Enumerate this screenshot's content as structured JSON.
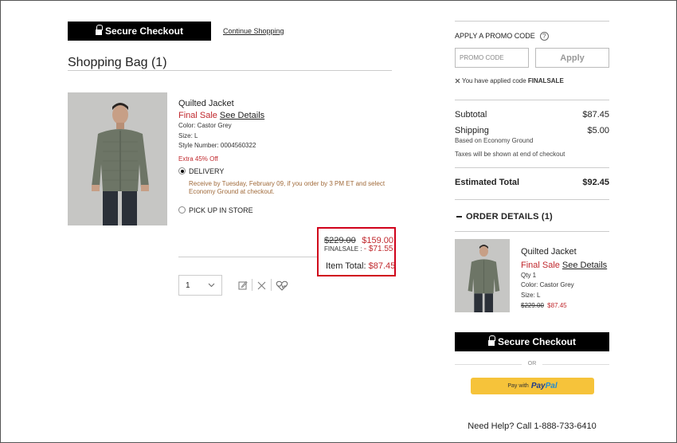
{
  "header": {
    "checkout_label": "Secure Checkout",
    "continue_label": "Continue Shopping",
    "bag_title": "Shopping Bag (1)"
  },
  "item": {
    "name": "Quilted Jacket",
    "final_sale": "Final Sale",
    "see_details": "See Details",
    "color": "Color: Castor Grey",
    "size_prefix": "Size: ",
    "size": "L",
    "style_prefix": "Style Number: ",
    "style_number": "0004560322",
    "discount_note": "Extra 45% Off",
    "delivery_label": "DELIVERY",
    "delivery_note_1": "Receive by Tuesday, February 09, if you order by 3 PM ET and select",
    "delivery_note_2": "Economy Ground at checkout.",
    "pickup_label": "PICK UP IN STORE",
    "quantity": "1"
  },
  "price_box": {
    "original": "$229.00",
    "sale": "$159.00",
    "promo_label": "FINALSALE : ",
    "promo_discount": "- $71.55",
    "total_label": "Item Total: ",
    "total_value": "$87.45"
  },
  "promo": {
    "title": "APPLY A PROMO CODE",
    "help": "?",
    "placeholder": "PROMO CODE",
    "apply_label": "Apply",
    "applied_text": "You have applied code ",
    "applied_code": "FINALSALE"
  },
  "summary": {
    "subtotal_label": "Subtotal",
    "subtotal_value": "$87.45",
    "shipping_label": "Shipping",
    "shipping_value": "$5.00",
    "shipping_method": "Based on Economy Ground",
    "tax_note": "Taxes will be shown at end of checkout",
    "estimated_label": "Estimated Total",
    "estimated_value": "$92.45"
  },
  "order_details": {
    "title": "ORDER DETAILS (1)",
    "name": "Quilted Jacket",
    "final_sale": "Final Sale",
    "see_details": "See Details",
    "qty": "Qty 1",
    "color": "Color: Castor Grey",
    "size": "Size: L",
    "original": "$229.00",
    "price": "$87.45"
  },
  "checkout": {
    "label": "Secure Checkout",
    "or": "OR",
    "paypal_prefix": "Pay with",
    "paypal_logo_a": "Pay",
    "paypal_logo_b": "Pal"
  },
  "help": {
    "text": "Need Help? Call 1-888-733-6410"
  },
  "colors": {
    "accent_red": "#c0282d",
    "box_red": "#d0021b",
    "paypal_yellow": "#f6c33a"
  }
}
